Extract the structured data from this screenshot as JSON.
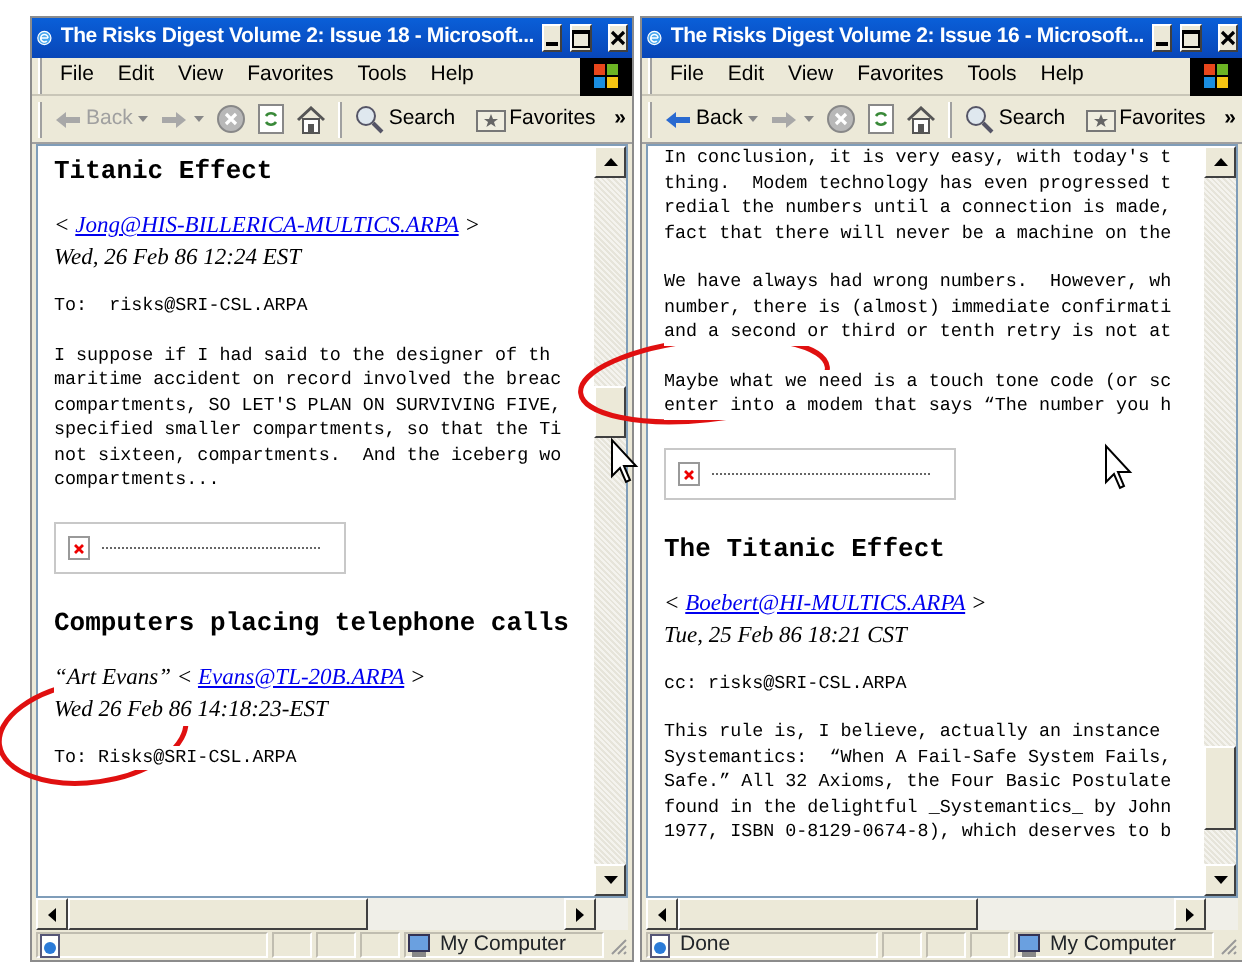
{
  "windows": [
    {
      "title": "The Risks Digest Volume 2: Issue 18 - Microsoft...",
      "menu": [
        "File",
        "Edit",
        "View",
        "Favorites",
        "Tools",
        "Help"
      ],
      "toolbar": {
        "back": "Back",
        "back_disabled": true,
        "search": "Search",
        "favorites": "Favorites",
        "more": "»"
      },
      "content": [
        {
          "kind": "heading",
          "text": "Titanic Effect"
        },
        {
          "kind": "sender",
          "prefix": "<",
          "link": "Jong@HIS-BILLERICA-MULTICS.ARPA",
          "suffix": ">",
          "date": "Wed, 26 Feb 86 12:24 EST"
        },
        {
          "kind": "para",
          "lines": [
            "To:  risks@SRI-CSL.ARPA"
          ]
        },
        {
          "kind": "para",
          "lines": [
            "I suppose if I had said to the designer of th",
            "maritime accident on record involved the breac",
            "compartments, SO LET'S PLAN ON SURVIVING FIVE,",
            "specified smaller compartments, so that the Ti",
            "not sixteen, compartments.  And the iceberg wo",
            "compartments..."
          ]
        },
        {
          "kind": "broken_image"
        },
        {
          "kind": "heading",
          "text": "Computers placing telephone calls"
        },
        {
          "kind": "sender",
          "prefix": "“Art Evans” <",
          "link": "Evans@TL-20B.ARPA",
          "suffix": ">",
          "date": "Wed 26 Feb 86 14:18:23-EST"
        },
        {
          "kind": "para",
          "lines": [
            "To: Risks@SRI-CSL.ARPA"
          ]
        }
      ],
      "status": {
        "zone": "My Computer"
      }
    },
    {
      "title": "The Risks Digest Volume 2: Issue 16 - Microsoft...",
      "menu": [
        "File",
        "Edit",
        "View",
        "Favorites",
        "Tools",
        "Help"
      ],
      "toolbar": {
        "back": "Back",
        "back_disabled": false,
        "search": "Search",
        "favorites": "Favorites",
        "more": "»"
      },
      "content": [
        {
          "kind": "para",
          "lines": [
            "In conclusion, it is very easy, with today's t",
            "thing.  Modem technology has even progressed t",
            "redial the numbers until a connection is made,",
            "fact that there will never be a machine on the"
          ]
        },
        {
          "kind": "para",
          "lines": [
            "We have always had wrong numbers.  However, wh",
            "number, there is (almost) immediate confirmati",
            "and a second or third or tenth retry is not at"
          ]
        },
        {
          "kind": "para",
          "lines": [
            "Maybe what we need is a touch tone code (or sc",
            "enter into a modem that says “The number you h"
          ]
        },
        {
          "kind": "broken_image"
        },
        {
          "kind": "heading",
          "text": "The Titanic Effect"
        },
        {
          "kind": "sender",
          "prefix": "<",
          "link": "Boebert@HI-MULTICS.ARPA",
          "suffix": ">",
          "date": "Tue, 25 Feb 86 18:21 CST"
        },
        {
          "kind": "para",
          "lines": [
            "cc: risks@SRI-CSL.ARPA"
          ]
        },
        {
          "kind": "para",
          "lines": [
            "This rule is, I believe, actually an instance",
            "Systemantics:  “When A Fail-Safe System Fails,",
            "Safe.” All 32 Axioms, the Four Basic Postulate",
            "found in the delightful _Systemantics_ by John",
            "1977, ISBN 0-8129-0674-8), which deserves to b"
          ]
        }
      ],
      "status": {
        "text": "Done",
        "zone": "My Computer"
      }
    }
  ]
}
